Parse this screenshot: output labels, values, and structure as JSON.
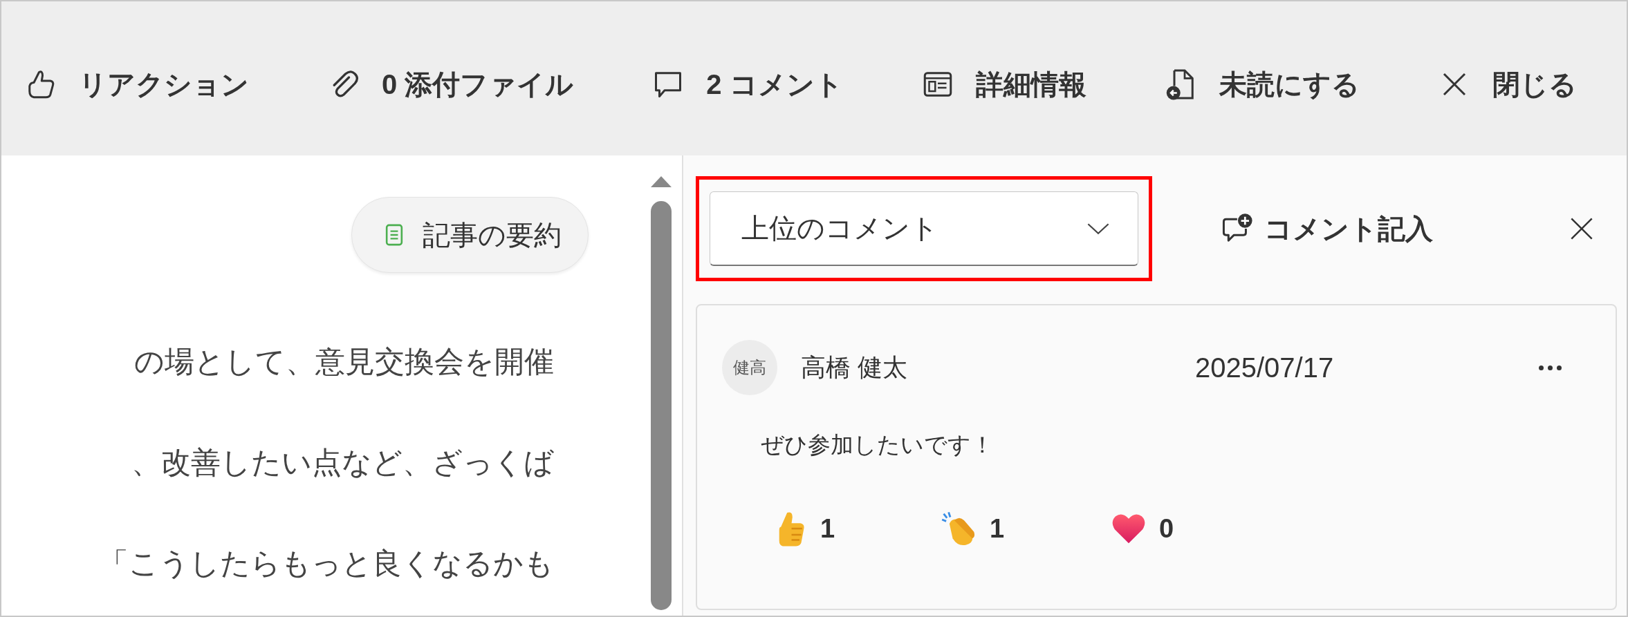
{
  "toolbar": {
    "items": [
      {
        "kind": "reaction",
        "label": "リアクション"
      },
      {
        "kind": "attachment",
        "label": "0 添付ファイル"
      },
      {
        "kind": "comment",
        "label": "2 コメント"
      },
      {
        "kind": "details",
        "label": "詳細情報"
      },
      {
        "kind": "unread",
        "label": "未読にする"
      },
      {
        "kind": "close",
        "label": "閉じる"
      }
    ]
  },
  "article": {
    "summary_button": "記事の要約",
    "paragraphs": [
      "の場として、意見交換会を開催",
      "、改善したい点など、ざっくば",
      "「こうしたらもっと良くなるかも"
    ]
  },
  "comments_panel": {
    "sort": {
      "value": "上位のコメント",
      "highlighted": true
    },
    "add_comment": "コメント記入",
    "comments": [
      {
        "initials": "健高",
        "author": "高橋 健太",
        "date": "2025/07/17",
        "text": "ぜひ参加したいです！",
        "reactions": [
          {
            "kind": "like",
            "count": "1"
          },
          {
            "kind": "clap",
            "count": "1"
          },
          {
            "kind": "heart",
            "count": "0"
          }
        ]
      }
    ]
  }
}
